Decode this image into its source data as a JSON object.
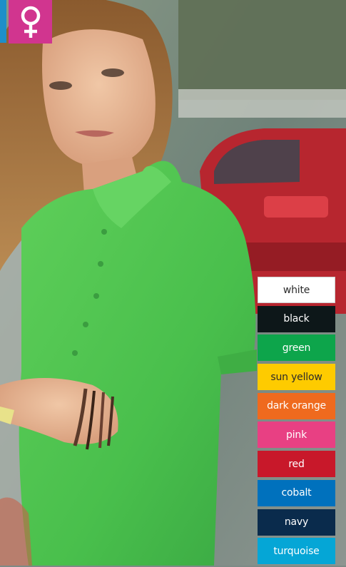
{
  "icons": {
    "female_badge": "female-symbol-icon",
    "female_badge_color": "#d1358f",
    "side_badge_color": "#1e8fc9"
  },
  "colors": [
    {
      "label": "white",
      "hex": "#ffffff"
    },
    {
      "label": "black",
      "hex": "#0d1719"
    },
    {
      "label": "green",
      "hex": "#0da54b"
    },
    {
      "label": "sun yellow",
      "hex": "#fecb00"
    },
    {
      "label": "dark orange",
      "hex": "#ef6a1e"
    },
    {
      "label": "pink",
      "hex": "#e84083"
    },
    {
      "label": "red",
      "hex": "#c8182a"
    },
    {
      "label": "cobalt",
      "hex": "#0071bd"
    },
    {
      "label": "navy",
      "hex": "#0a2b4c"
    },
    {
      "label": "turquoise",
      "hex": "#05a6d6"
    }
  ]
}
